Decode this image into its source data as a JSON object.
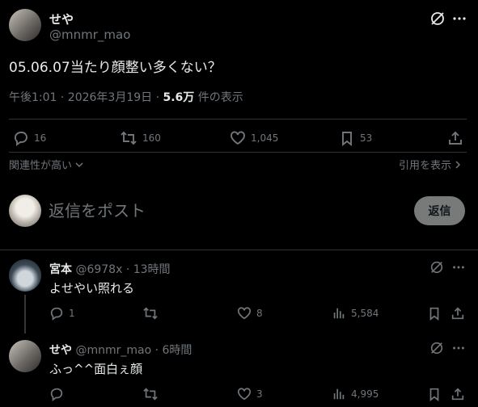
{
  "main_tweet": {
    "display_name": "せや",
    "handle": "@mnmr_mao",
    "text": "05.06.07当たり顔整い多くない？",
    "time": "午後1:01 · 2026年3月19日 ·",
    "views": "5.6万",
    "views_suffix": "件の表示",
    "stats": {
      "replies": "16",
      "reposts": "160",
      "likes": "1,045",
      "bookmarks": "53"
    }
  },
  "sort": {
    "left_label": "関連性が高い",
    "right_label": "引用を表示"
  },
  "composer": {
    "placeholder": "返信をポスト",
    "reply_button": "返信"
  },
  "replies": [
    {
      "display_name": "宮本",
      "handle": "@6978x",
      "time": "· 13時間",
      "text": "よせやい照れる",
      "stats": {
        "replies": "1",
        "reposts": "",
        "likes": "8",
        "views": "5,584"
      }
    },
    {
      "display_name": "せや",
      "handle": "@mnmr_mao",
      "time": "· 6時間",
      "text": "ふっ^^面白ぇ顔",
      "stats": {
        "replies": "",
        "reposts": "",
        "likes": "3",
        "views": "4,995"
      }
    }
  ]
}
